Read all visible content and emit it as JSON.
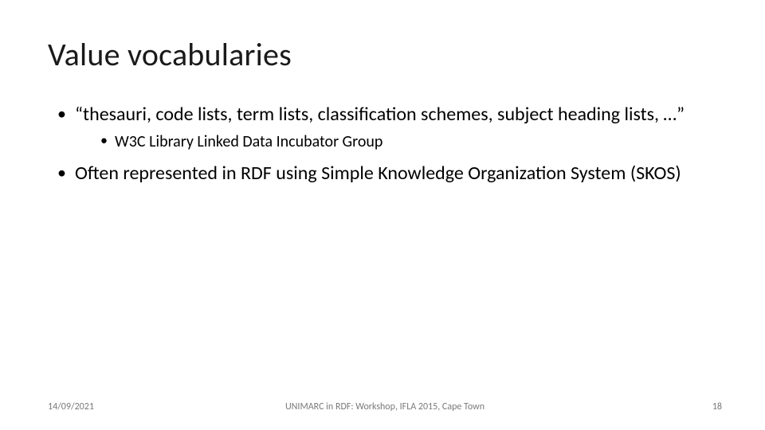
{
  "title": "Value vocabularies",
  "bullets": {
    "item1": "“thesauri, code lists, term lists, classification schemes, subject heading lists, …”",
    "item1_sub1": "W3C Library Linked Data Incubator Group",
    "item2": "Often represented in RDF using Simple Knowledge Organization System (SKOS)"
  },
  "footer": {
    "date": "14/09/2021",
    "center": "UNIMARC in RDF: Workshop, IFLA 2015, Cape Town",
    "page": "18"
  }
}
